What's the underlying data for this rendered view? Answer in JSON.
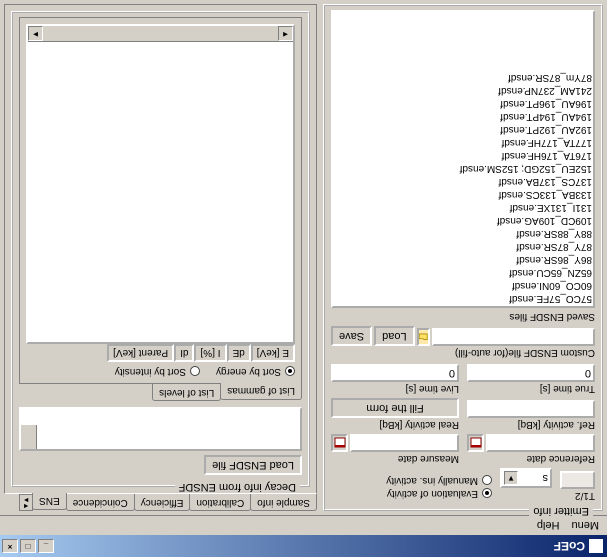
{
  "window": {
    "title": "CoEF"
  },
  "menu": {
    "items": [
      "Menu",
      "Help"
    ]
  },
  "left_panel": {
    "title": "Emitter info",
    "halflife_label": "T1/2",
    "unit_select": "s",
    "radio_eval": "Evaluation of activity",
    "radio_manual": "Manually ins. activity",
    "ref_date_label": "Reference date",
    "meas_date_label": "Measure date",
    "ref_act_label": "Ref. activity [kBq]",
    "real_act_label": "Real activity [kBq]",
    "fill_button": "Fill the form",
    "true_time_label": "True time [s]",
    "live_time_label": "Live time [s]",
    "true_time": "0",
    "live_time": "0",
    "custom_file_label": "Custom ENSDF file(for auto-fill)",
    "load_btn": "Load",
    "save_btn": "Save",
    "saved_label": "Saved ENSDF files",
    "files": [
      "57CO_57FE.ensdf",
      "60CO_60NI.ensdf",
      "65ZN_65CU.ensdf",
      "86Y_86SR.ensdf",
      "87Y_87SR.ensdf",
      "88Y_88SR.ensdf",
      "109CD_109AG.ensdf",
      "131I_131XE.ensdf",
      "133BA_133CS.ensdf",
      "137CS_137BA.ensdf",
      "152EU_152GD; 152SM.ensdf",
      "176TA_176HF.ensdf",
      "177TA_177HF.ensdf",
      "192AU_192PT.ensdf",
      "194AU_194PT.ensdf",
      "196AU_196PT.ensdf",
      "241AM_237NP.ensdf",
      "87Ym_87SR.ensdf"
    ]
  },
  "right_panel": {
    "tabs": [
      "Sample info",
      "Calibration",
      "Efficiency",
      "Coincidence",
      "ENS"
    ],
    "decay_title": "Decay info from ENSDF",
    "load_ensdf": "Load ENSDF file",
    "sub_tabs": [
      "List of gammas",
      "List of levels"
    ],
    "sort_energy": "Sort by energy",
    "sort_intensity": "Sort by intensity",
    "columns": [
      "E [keV]",
      "dE",
      "I [%]",
      "dI",
      "Parent [keV]"
    ]
  }
}
